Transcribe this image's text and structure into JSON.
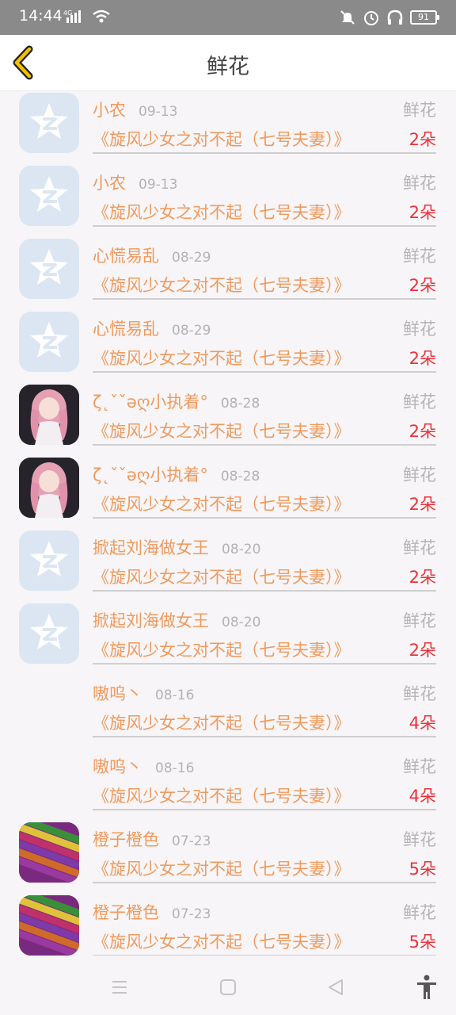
{
  "status_bar": {
    "time": "14:44",
    "network": "4G",
    "battery": "91"
  },
  "header": {
    "title": "鲜花"
  },
  "items": [
    {
      "name": "小农",
      "date": "09-13",
      "gift": "鲜花",
      "work": "《旋风少女之对不起（七号夫妻）》",
      "count": "2朵",
      "avatar": "qzone-default-avatar"
    },
    {
      "name": "小农",
      "date": "09-13",
      "gift": "鲜花",
      "work": "《旋风少女之对不起（七号夫妻）》",
      "count": "2朵",
      "avatar": "qzone-default-avatar"
    },
    {
      "name": "心慌易乱",
      "date": "08-29",
      "gift": "鲜花",
      "work": "《旋风少女之对不起（七号夫妻）》",
      "count": "2朵",
      "avatar": "qzone-default-avatar"
    },
    {
      "name": "心慌易乱",
      "date": "08-29",
      "gift": "鲜花",
      "work": "《旋风少女之对不起（七号夫妻）》",
      "count": "2朵",
      "avatar": "qzone-default-avatar"
    },
    {
      "name": "ζ˛ˇˇəღ小执着°",
      "date": "08-28",
      "gift": "鲜花",
      "work": "《旋风少女之对不起（七号夫妻）》",
      "count": "2朵",
      "avatar": "anime-girl-avatar"
    },
    {
      "name": "ζ˛ˇˇəღ小执着°",
      "date": "08-28",
      "gift": "鲜花",
      "work": "《旋风少女之对不起（七号夫妻）》",
      "count": "2朵",
      "avatar": "anime-girl-avatar"
    },
    {
      "name": "掀起刘海做女王",
      "date": "08-20",
      "gift": "鲜花",
      "work": "《旋风少女之对不起（七号夫妻）》",
      "count": "2朵",
      "avatar": "qzone-default-avatar"
    },
    {
      "name": "掀起刘海做女王",
      "date": "08-20",
      "gift": "鲜花",
      "work": "《旋风少女之对不起（七号夫妻）》",
      "count": "2朵",
      "avatar": "qzone-default-avatar"
    },
    {
      "name": "嗷呜丶",
      "date": "08-16",
      "gift": "鲜花",
      "work": "《旋风少女之对不起（七号夫妻）》",
      "count": "4朵",
      "avatar": ""
    },
    {
      "name": "嗷呜丶",
      "date": "08-16",
      "gift": "鲜花",
      "work": "《旋风少女之对不起（七号夫妻）》",
      "count": "4朵",
      "avatar": ""
    },
    {
      "name": "橙子橙色",
      "date": "07-23",
      "gift": "鲜花",
      "work": "《旋风少女之对不起（七号夫妻）》",
      "count": "5朵",
      "avatar": "colored-pencils-avatar"
    },
    {
      "name": "橙子橙色",
      "date": "07-23",
      "gift": "鲜花",
      "work": "《旋风少女之对不起（七号夫妻）》",
      "count": "5朵",
      "avatar": "colored-pencils-avatar"
    }
  ],
  "nav_bar": {
    "icons": [
      "menu-icon",
      "home-icon",
      "back-icon",
      "accessibility-icon"
    ]
  },
  "colors": {
    "name": "#ef9a5d",
    "count": "#e8333b",
    "muted": "#b5b5b5",
    "accent": "#f2c200"
  }
}
